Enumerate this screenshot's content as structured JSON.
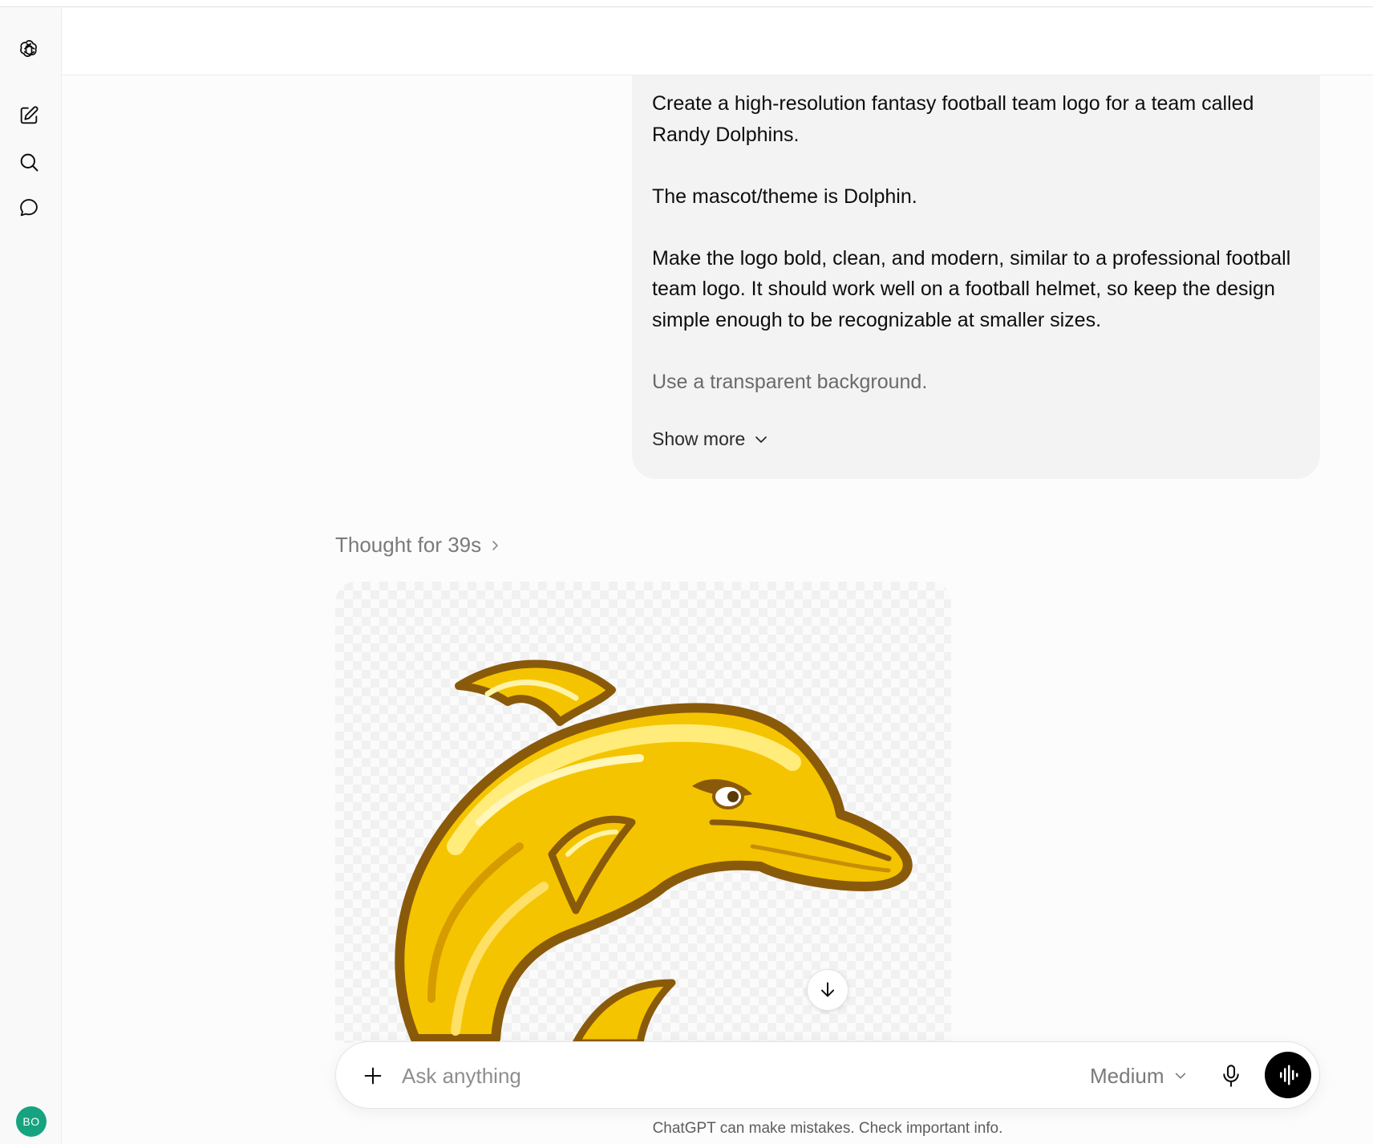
{
  "sidebar": {
    "logo_icon": "openai-logo-icon",
    "new_chat_icon": "edit-icon",
    "search_icon": "search-icon",
    "chats_icon": "chat-bubble-icon",
    "avatar_initials": "BO",
    "avatar_color": "#16a37f"
  },
  "conversation": {
    "user_message": {
      "paragraphs": [
        "Create a high-resolution fantasy football team logo for a team called Randy Dolphins.",
        "The mascot/theme is Dolphin.",
        "Make the logo bold, clean, and modern, similar to a professional football team logo. It should work well on a football helmet, so keep the design simple enough to be recognizable at smaller sizes.",
        "Use a transparent background."
      ],
      "show_more_label": "Show more"
    },
    "assistant": {
      "thought_label": "Thought for 39s",
      "image_subject": "yellow dolphin mascot logo on transparent background"
    }
  },
  "composer": {
    "placeholder": "Ask anything",
    "model_label": "Medium",
    "plus_icon": "plus-icon",
    "mic_icon": "microphone-icon",
    "voice_icon": "voice-mode-icon"
  },
  "footer": {
    "disclaimer": "ChatGPT can make mistakes. Check important info."
  },
  "colors": {
    "accent_dark": "#000000",
    "bubble_bg": "#f3f3f3",
    "dolphin_yellow": "#f5c400",
    "dolphin_outline": "#8a5a0b"
  }
}
